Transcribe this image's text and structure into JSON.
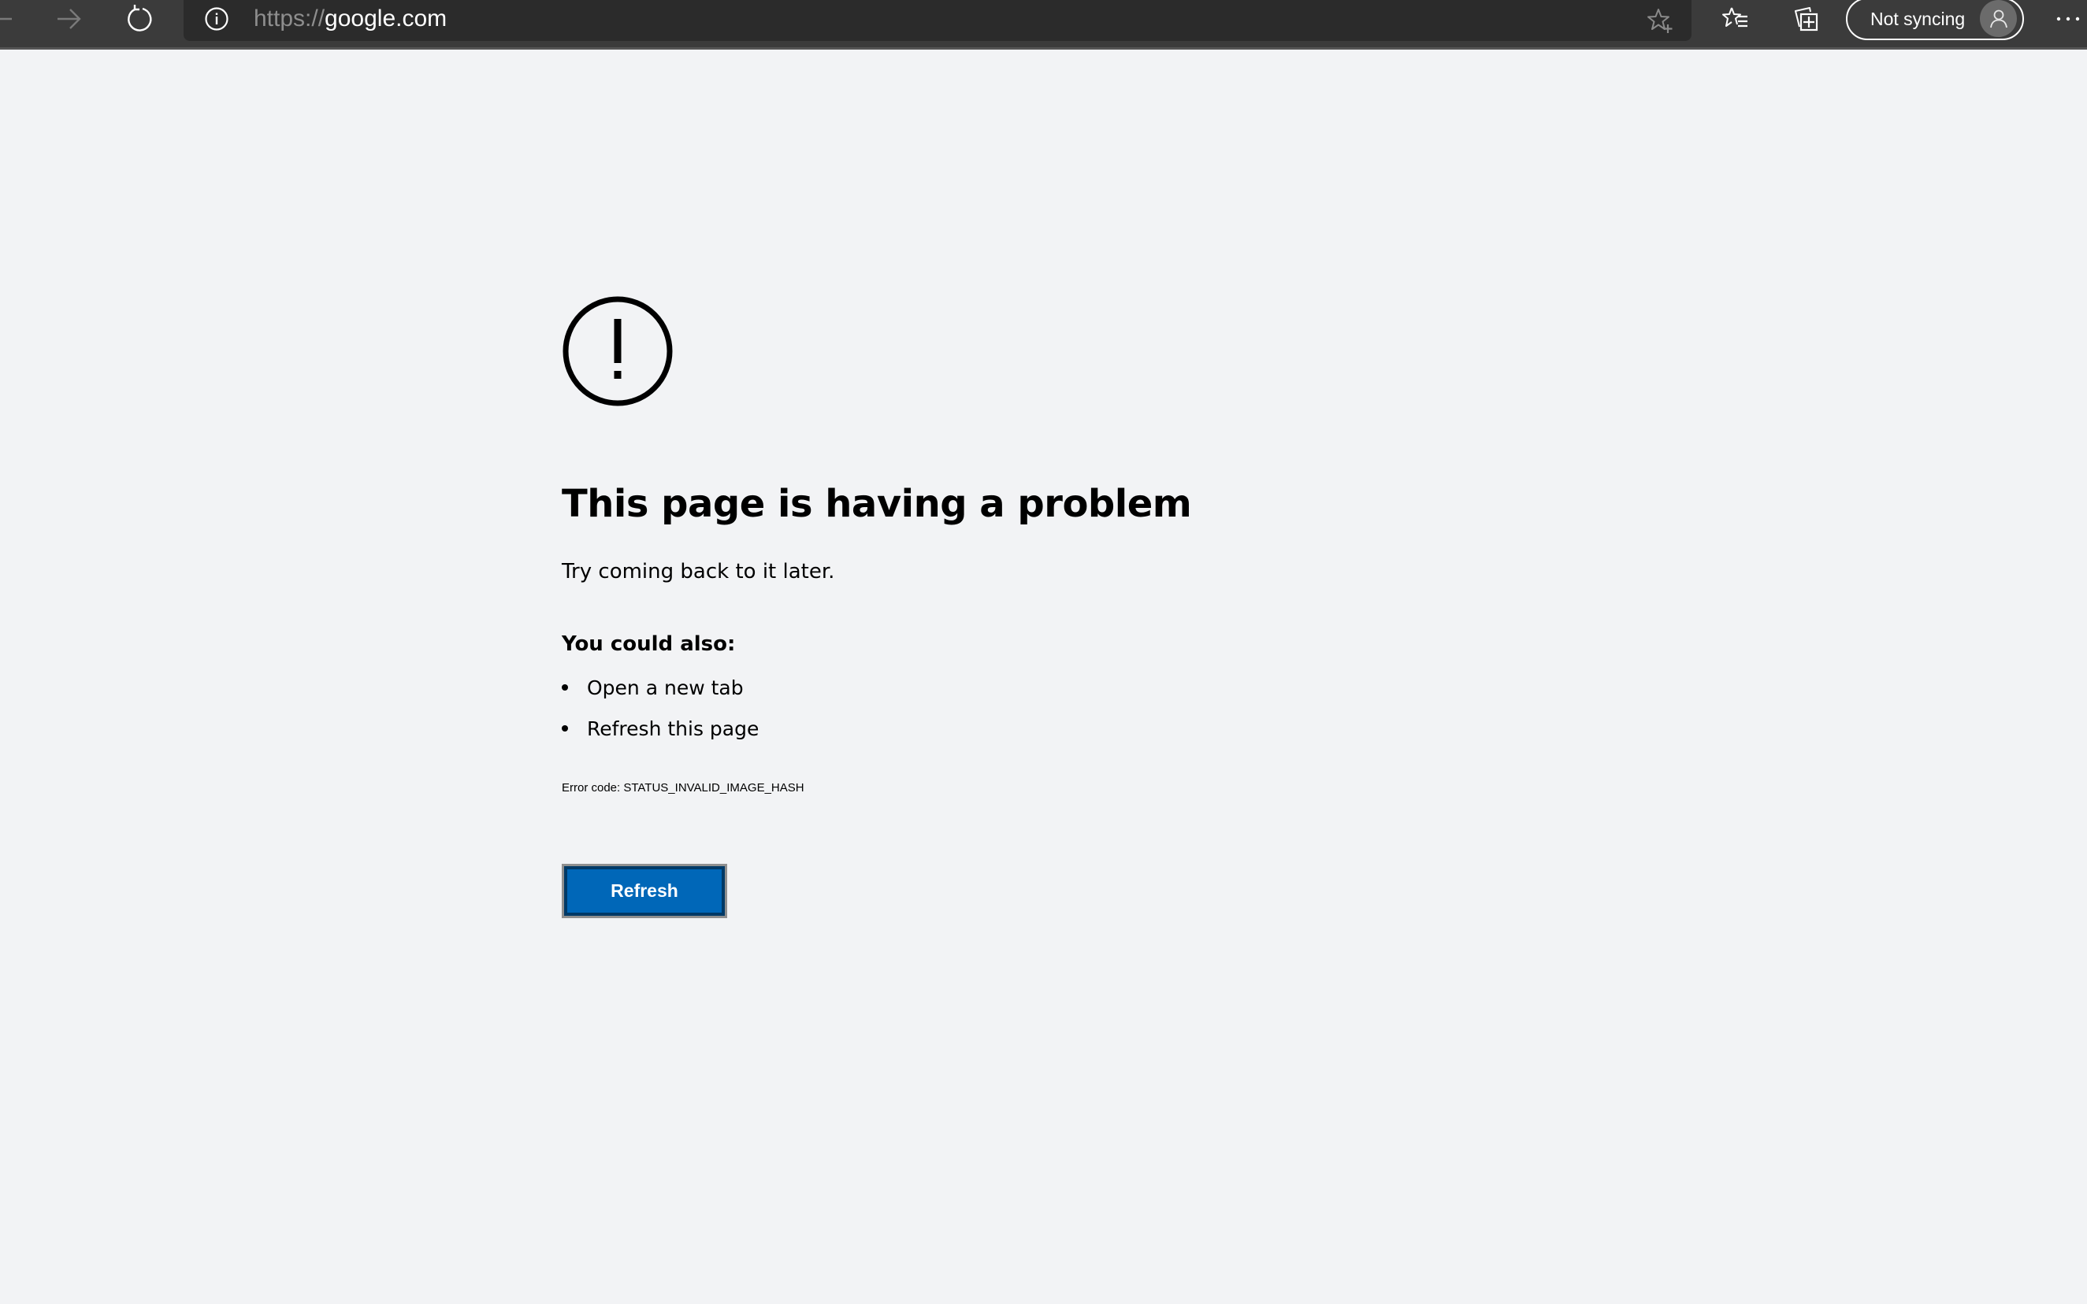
{
  "browser": {
    "address_bar": {
      "url_scheme": "https://",
      "url_host": "google.com"
    },
    "toolbar": {
      "back_icon": "arrow-left-icon",
      "forward_icon": "arrow-right-icon",
      "refresh_icon": "refresh-icon",
      "site_info_icon": "info-icon",
      "add_favorite_icon": "star-plus-icon",
      "favorites_icon": "favorites-list-icon",
      "collections_icon": "collections-icon",
      "profile": {
        "label": "Not syncing",
        "avatar_icon": "person-icon"
      },
      "more_icon": "ellipsis-icon"
    },
    "colors": {
      "toolbar_bg": "#3b3b3b",
      "address_bar_bg": "#2b2b2b",
      "page_bg": "#f2f3f5",
      "accent": "#0067b8"
    }
  },
  "error_page": {
    "icon": "exclamation-circle-icon",
    "heading": "This page is having a problem",
    "subtitle": "Try coming back to it later.",
    "suggestions_title": "You could also:",
    "suggestions": [
      "Open a new tab",
      "Refresh this page"
    ],
    "error_code": "Error code: STATUS_INVALID_IMAGE_HASH",
    "refresh_button_label": "Refresh"
  }
}
